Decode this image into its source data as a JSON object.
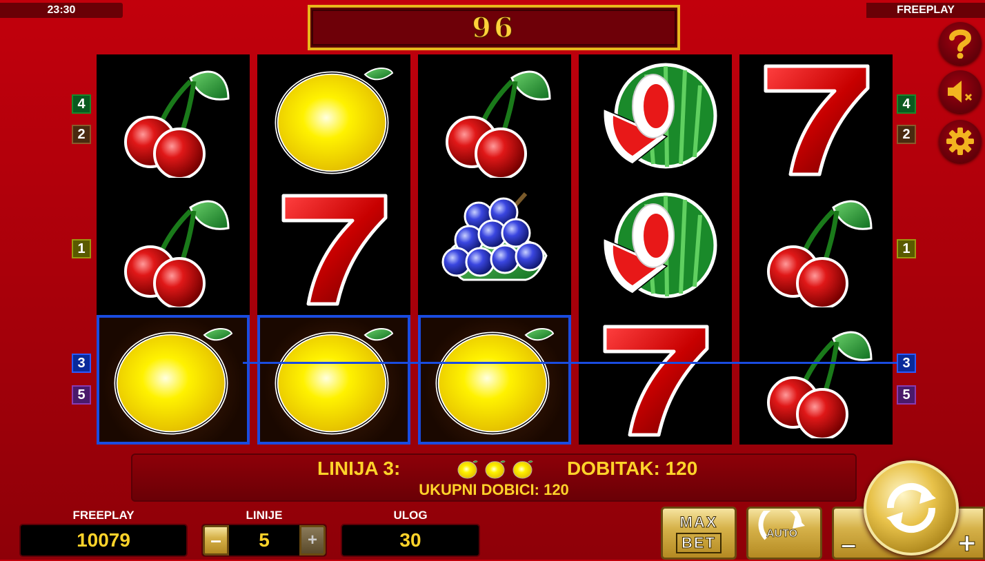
{
  "top": {
    "clock": "23:30",
    "mode": "FREEPLAY",
    "jackpot": "96"
  },
  "colors": {
    "background": "#b0000a",
    "accent_gold": "#ffd32a",
    "payline_blue": "#1a4ce0"
  },
  "reels": [
    [
      "cherry",
      "cherry",
      "lemon"
    ],
    [
      "lemon",
      "seven",
      "lemon"
    ],
    [
      "cherry",
      "grapes",
      "lemon"
    ],
    [
      "watermelon",
      "watermelon",
      "seven"
    ],
    [
      "seven",
      "cherry",
      "cherry"
    ]
  ],
  "line_badges": {
    "left": [
      "4",
      "2",
      "1",
      "3",
      "5"
    ],
    "right": [
      "4",
      "2",
      "1",
      "3",
      "5"
    ]
  },
  "win": {
    "line_label": "LINIJA 3:",
    "symbols": [
      "lemon",
      "lemon",
      "lemon"
    ],
    "win_label": "DOBITAK: 120",
    "total_label": "UKUPNI DOBICI: 120"
  },
  "footer": {
    "balance_label": "FREEPLAY",
    "balance_value": "10079",
    "lines_label": "LINIJE",
    "lines_value": "5",
    "bet_label": "ULOG",
    "bet_value": "30",
    "minus_label": "–",
    "plus_label": "+",
    "max_label": "MAX",
    "bet_btn_label": "BET",
    "auto_label": "AUTO"
  },
  "icons": [
    "help-icon",
    "sound-muted-icon",
    "settings-gear-icon",
    "spin-icon"
  ]
}
